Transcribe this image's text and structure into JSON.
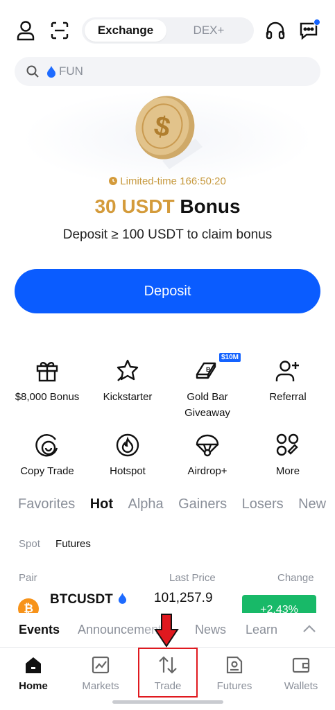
{
  "header": {
    "segments": [
      "Exchange",
      "DEX+"
    ],
    "active_segment": "Exchange"
  },
  "search": {
    "text": "FUN"
  },
  "promo": {
    "limited_label": "Limited-time",
    "countdown": "166:50:20",
    "amount": "30 USDT",
    "bonus_word": "Bonus",
    "subtitle": "Deposit ≥ 100 USDT to claim bonus",
    "deposit_label": "Deposit"
  },
  "quick_actions": [
    {
      "label": "$8,000 Bonus",
      "icon": "gift-icon"
    },
    {
      "label": "Kickstarter",
      "icon": "star-rocket-icon"
    },
    {
      "label": "Gold Bar Giveaway",
      "icon": "gold-bar-icon",
      "badge": "$10M"
    },
    {
      "label": "Referral",
      "icon": "add-user-icon"
    },
    {
      "label": "Copy Trade",
      "icon": "copy-trade-icon"
    },
    {
      "label": "Hotspot",
      "icon": "flame-icon"
    },
    {
      "label": "Airdrop+",
      "icon": "parachute-icon"
    },
    {
      "label": "More",
      "icon": "grid-more-icon"
    }
  ],
  "market_tabs": [
    "Favorites",
    "Hot",
    "Alpha",
    "Gainers",
    "Losers",
    "New"
  ],
  "active_market_tab": "Hot",
  "sub_tabs": [
    "Spot",
    "Futures"
  ],
  "active_sub_tab": "Futures",
  "columns": {
    "pair": "Pair",
    "last_price": "Last Price",
    "change": "Change"
  },
  "rows": [
    {
      "pair": "BTCUSDT",
      "price": "101,257.9",
      "change": "+2.43%",
      "logo": "₿"
    }
  ],
  "events_tabs": [
    "Events",
    "Announcements",
    "News",
    "Learn"
  ],
  "active_events_tab": "Events",
  "bottom_nav": [
    {
      "label": "Home",
      "icon": "home-icon"
    },
    {
      "label": "Markets",
      "icon": "chart-icon"
    },
    {
      "label": "Trade",
      "icon": "trade-arrows-icon"
    },
    {
      "label": "Futures",
      "icon": "futures-icon"
    },
    {
      "label": "Wallets",
      "icon": "wallet-icon"
    }
  ],
  "active_nav": "Home",
  "colors": {
    "accent": "#0a5cff",
    "gold": "#d49b3b",
    "positive": "#18b968",
    "annotation": "#e0191f"
  }
}
